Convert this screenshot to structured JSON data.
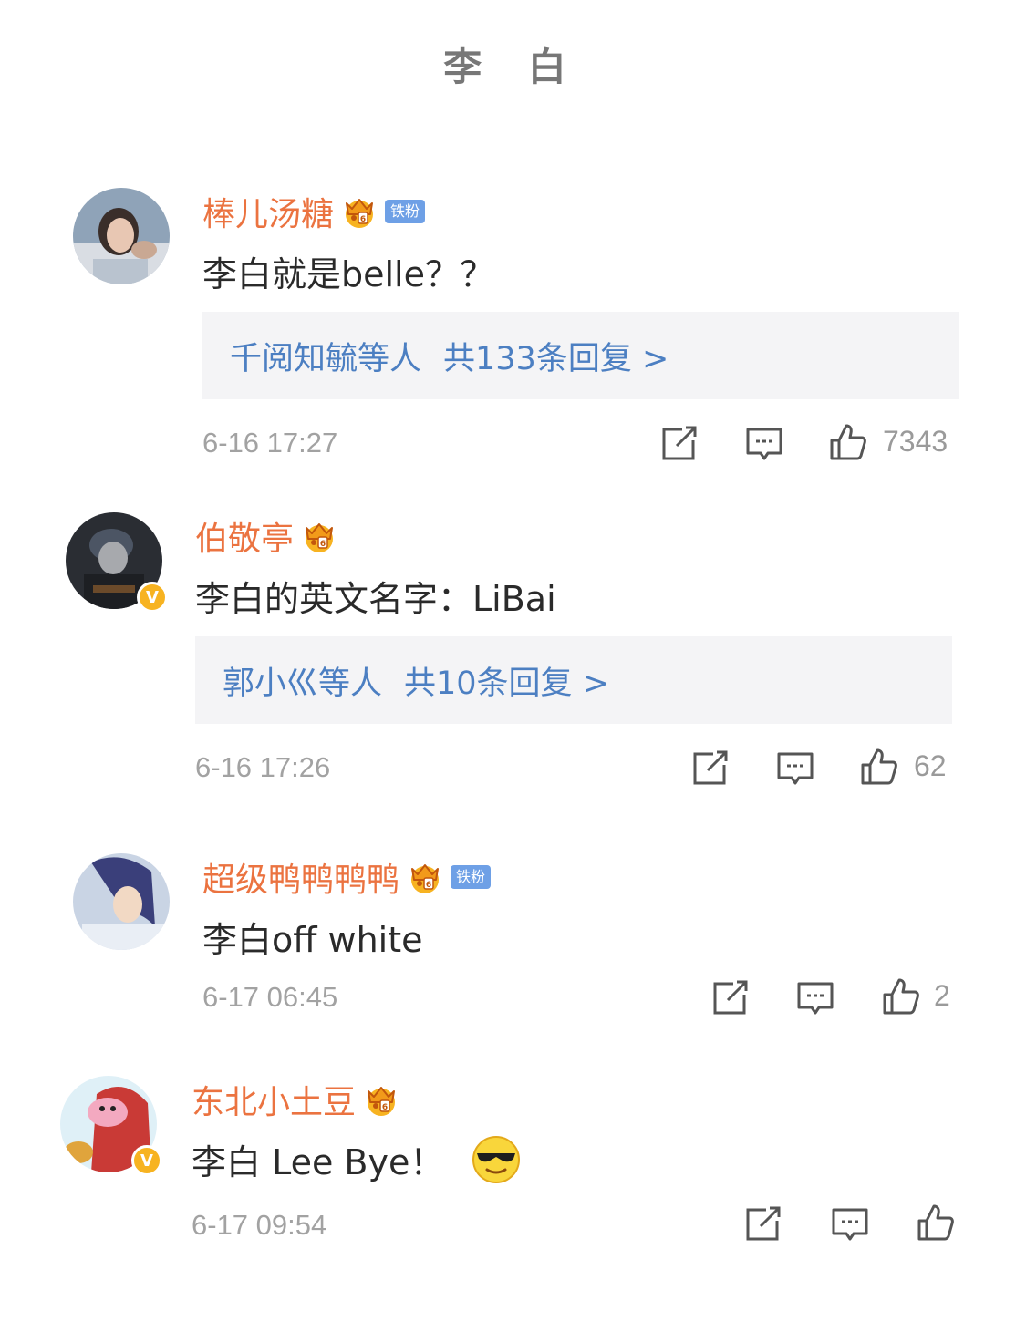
{
  "header": {
    "title": "李 白"
  },
  "colors": {
    "username": "#eb7340",
    "reply_link": "#4c7fc2",
    "timestamp": "#a2a2a2",
    "verified": "#f7b321",
    "fan_badge": "#6ea0e6"
  },
  "comments": [
    {
      "username": "棒儿汤糖",
      "crown_icon": "crown-icon",
      "fan_badge": "铁粉",
      "text": "李白就是belle？？",
      "reply_summary": {
        "who": "千阅知毓等人",
        "count": "共133条回复 >"
      },
      "time": "6-16 17:27",
      "likes": "7343"
    },
    {
      "username": "伯敬亭",
      "crown_icon": "crown-icon",
      "verified": "V",
      "text": "李白的英文名字：LiBai",
      "reply_summary": {
        "who": "郭小巛等人",
        "count": "共10条回复 >"
      },
      "time": "6-16 17:26",
      "likes": "62"
    },
    {
      "username": "超级鸭鸭鸭鸭",
      "crown_icon": "crown-icon",
      "fan_badge": "铁粉",
      "text": "李白off white",
      "time": "6-17 06:45",
      "likes": "2"
    },
    {
      "username": "东北小土豆",
      "crown_icon": "crown-icon",
      "verified": "V",
      "text": "李白 Lee Bye！",
      "emoji": "sunglasses-emoji",
      "time": "6-17 09:54",
      "likes": ""
    }
  ],
  "icons": {
    "share": "share-icon",
    "comment": "comment-icon",
    "like": "thumbs-up-icon"
  }
}
